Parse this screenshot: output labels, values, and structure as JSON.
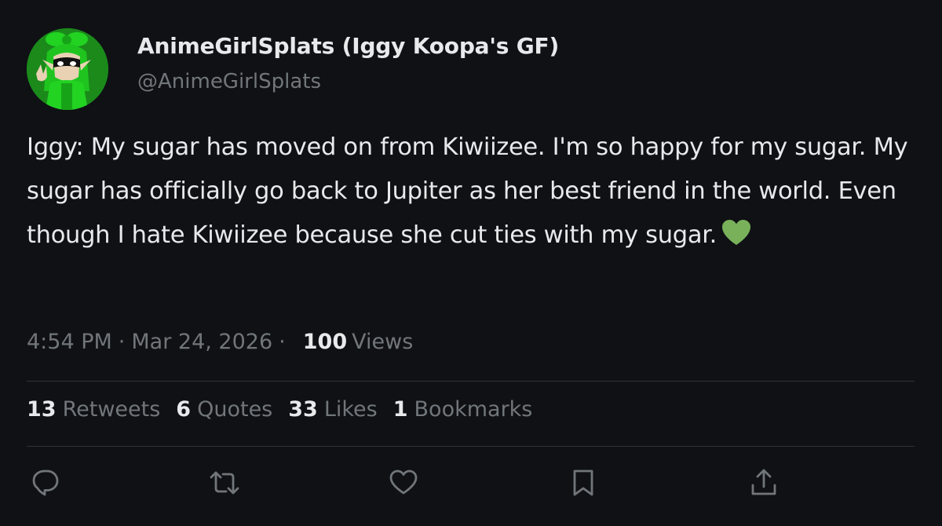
{
  "author": {
    "display_name": "AnimeGirlSplats (Iggy Koopa's GF)",
    "handle": "@AnimeGirlSplats"
  },
  "tweet": {
    "text": "Iggy: My sugar has moved on from Kiwiizee. I'm so happy for my sugar. My sugar has officially go back to Jupiter as her best friend in the world. Even though I hate Kiwiizee because she cut ties with my sugar.",
    "emoji": "green-heart"
  },
  "meta": {
    "time": "4:54 PM",
    "separator": "·",
    "date": "Mar 24, 2026",
    "views_count": "100",
    "views_label": "Views"
  },
  "stats": [
    {
      "count": "13",
      "label": "Retweets"
    },
    {
      "count": "6",
      "label": "Quotes"
    },
    {
      "count": "33",
      "label": "Likes"
    },
    {
      "count": "1",
      "label": "Bookmarks"
    }
  ],
  "actions": [
    "reply-icon",
    "retweet-icon",
    "like-icon",
    "bookmark-icon",
    "share-icon"
  ],
  "colors": {
    "background": "#0f1115",
    "text_primary": "#e7e9ea",
    "text_secondary": "#71767b",
    "divider": "#2f3336",
    "avatar_green": "#1fc41f",
    "heart_green": "#78b159"
  }
}
